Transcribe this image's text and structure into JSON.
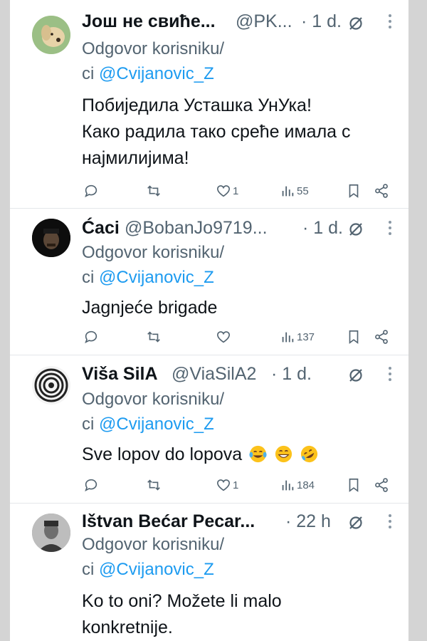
{
  "reply_prefix": "Odgovor korisniku/",
  "reply_line2_prefix": "ci",
  "tweets": [
    {
      "name": "Још не свиће...",
      "handle": "@PK...",
      "time": "· 1 d.",
      "mention": "@Cvijanovic_Z",
      "body": [
        "Побиједила Усташка УнУка!",
        "Како радила тако срећe имала с",
        "најмилијима!"
      ],
      "replies": "",
      "retweets": "",
      "likes": "1",
      "views": "55"
    },
    {
      "name": "Ćaci",
      "handle": "@BobanJo9719...",
      "time": "· 1 d.",
      "mention": "@Cvijanovic_Z",
      "body": [
        "Jagnjeće brigade"
      ],
      "replies": "",
      "retweets": "",
      "likes": "",
      "views": "137"
    },
    {
      "name": "Viša SilA",
      "handle": "@ViaSilA2",
      "time": "· 1 d.",
      "mention": "@Cvijanovic_Z",
      "body": [
        "Sve lopov do lopova"
      ],
      "emojis": [
        "face-with-tears-of-joy",
        "grinning-face",
        "rolling-on-the-floor-laughing"
      ],
      "replies": "",
      "retweets": "",
      "likes": "1",
      "views": "184"
    },
    {
      "name": "Ištvan Bećar Pecar...",
      "handle": "",
      "time": "· 22 h",
      "mention": "@Cvijanovic_Z",
      "body": [
        "Ko to oni? Možete li malo",
        "konkretnije."
      ],
      "replies": "",
      "retweets": "",
      "likes": "",
      "views": ""
    }
  ],
  "colors": {
    "link": "#1d9bf0",
    "text": "#0f1419",
    "muted": "#536471",
    "divider": "#e4e7ea"
  }
}
